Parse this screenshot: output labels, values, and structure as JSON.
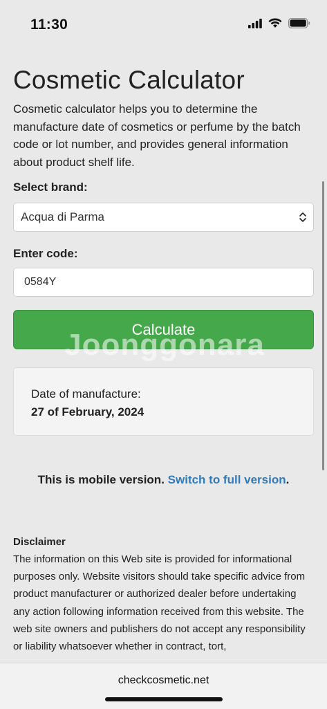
{
  "status_bar": {
    "time": "11:30"
  },
  "page": {
    "title": "Cosmetic Calculator",
    "intro": "Cosmetic calculator helps you to determine the manufacture date of cosmetics or perfume by the batch code or lot number, and provides general information about product shelf life."
  },
  "form": {
    "brand_label": "Select brand:",
    "brand_value": "Acqua di Parma",
    "code_label": "Enter code:",
    "code_value": "0584Y",
    "button_label": "Calculate"
  },
  "watermark": "Joonggonara",
  "result": {
    "label": "Date of manufacture:",
    "value": "27 of February, 2024"
  },
  "mobile_note": {
    "text": "This is mobile version.",
    "link": "Switch to full version",
    "suffix": "."
  },
  "disclaimer": {
    "title": "Disclaimer",
    "text": "The information on this Web site is provided for informational purposes only. Website visitors should take specific advice from product manufacturer or authorized dealer before undertaking any action following information received from this website. The web site owners and publishers do not accept any responsibility or liability whatsoever whether in contract, tort,"
  },
  "browser": {
    "domain": "checkcosmetic.net"
  }
}
